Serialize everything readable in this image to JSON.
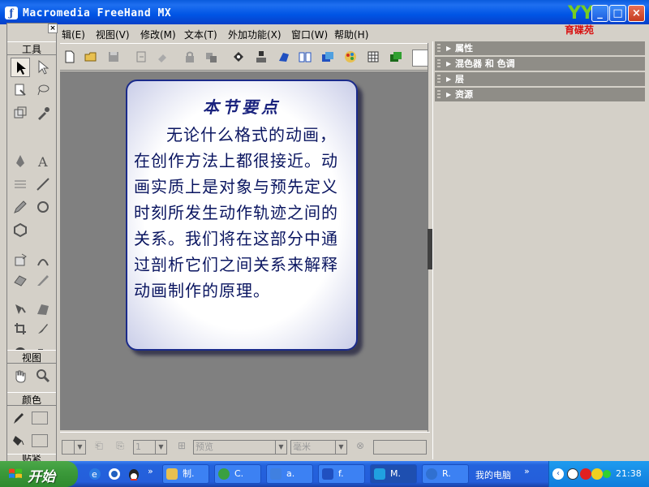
{
  "window": {
    "title": "Macromedia FreeHand MX",
    "brand_logo_letters": "YY",
    "brand_logo_text": "育碟苑",
    "minimize_symbol": "_",
    "maximize_symbol": "□",
    "close_symbol": "×"
  },
  "menubar": {
    "items": [
      "辑(E)",
      "视图(V)",
      "修改(M)",
      "文本(T)",
      "外加功能(X)",
      "窗口(W)",
      "帮助(H)"
    ]
  },
  "toolbar": {
    "icons": [
      "new-document-icon",
      "open-folder-icon",
      "save-icon",
      "import-icon",
      "export-icon",
      "lock-icon",
      "unlock-icon",
      "link-icon",
      "align-icon",
      "transform-icon",
      "library-icon",
      "layers-icon",
      "swatches-icon",
      "grid-icon",
      "stack-icon"
    ]
  },
  "tools": {
    "close_label": "×",
    "section_tools": "工具",
    "section_view": "视图",
    "section_colors": "颜色",
    "section_snap": "贴紧"
  },
  "document": {
    "card_title": "本节要点",
    "card_text": "无论什么格式的动画，在创作方法上都很接近。动画实质上是对象与预先定义时刻所发生动作轨迹之间的关系。我们将在这部分中通过剖析它们之间关系来解释动画制作的原理。"
  },
  "statusbar": {
    "page_value": "1",
    "preview_label": "预览",
    "units_label": "毫米"
  },
  "panels": {
    "items": [
      "属性",
      "混色器 和 色调",
      "层",
      "资源"
    ]
  },
  "taskbar": {
    "start_label": "开始",
    "buttons": [
      {
        "label": "制.",
        "icon_color": "#e8c050"
      },
      {
        "label": "C.",
        "icon_color": "#3aa040"
      },
      {
        "label": "a.",
        "icon_color": "#4080e0"
      },
      {
        "label": "f.",
        "icon_color": "#2050c0"
      },
      {
        "label": "M.",
        "icon_color": "#20a0e0"
      },
      {
        "label": "R.",
        "icon_color": "#3070d0"
      }
    ],
    "my_computer": "我的电脑",
    "clock": "21:38"
  }
}
